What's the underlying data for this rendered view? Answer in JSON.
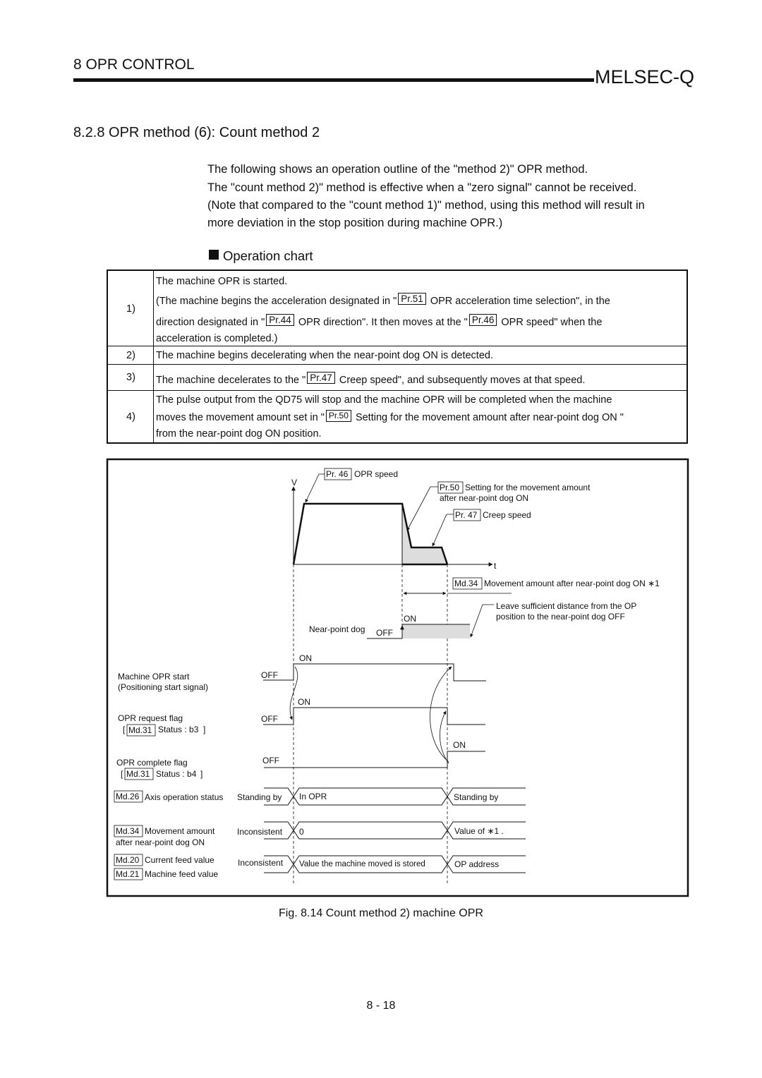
{
  "header": {
    "chapter": "8   OPR CONTROL",
    "brand": "MELSEC-Q"
  },
  "section_title": "8.2.8 OPR method (6): Count method 2",
  "intro": [
    "The following shows an operation outline of the \"method 2)\" OPR method.",
    "The \"count method 2)\" method is effective when a \"zero signal\" cannot be received.",
    "(Note that compared to the \"count method 1)\" method, using this method will result in",
    "more deviation in the stop position during machine OPR.)"
  ],
  "operation_chart_title": "Operation chart",
  "table": {
    "r1": {
      "num": "1)",
      "l1": "The machine OPR is started.",
      "l2a": "(The machine begins the acceleration designated in \"",
      "l2ref": "Pr.51",
      "l2b": "OPR acceleration time selection\", in the",
      "l3a": "direction designated in \"",
      "l3ref1": "Pr.44",
      "l3b": "OPR direction\". It then moves at the \"",
      "l3ref2": "Pr.46",
      "l3c": "OPR speed\" when the",
      "l4": "acceleration is completed.)"
    },
    "r2": {
      "num": "2)",
      "text": "The machine begins decelerating when the near-point dog ON is detected."
    },
    "r3": {
      "num": "3)",
      "a": "The machine decelerates to the \"",
      "ref": "Pr.47",
      "b": "Creep speed\", and subsequently moves at that speed."
    },
    "r4": {
      "num": "4)",
      "l1": "The pulse output from the QD75 will stop and the machine OPR will be completed when the machine",
      "l2a": "moves the movement amount set in \"",
      "l2ref": "Pr.50",
      "l2b": "Setting for the movement amount after near-point dog ON \"",
      "l3": "from the near-point dog ON position."
    }
  },
  "diagram": {
    "v": "V",
    "t": "t",
    "pr46": "Pr. 46",
    "pr46_text": "OPR speed",
    "pr50": "Pr.50",
    "pr50_text1": "Setting for the movement amount",
    "pr50_text2": "after near-point dog ON",
    "pr47": "Pr. 47",
    "pr47_text": "Creep speed",
    "md34": "Md.34",
    "md34_text": "Movement amount after near-point dog ON ∗1",
    "leave1": "Leave sufficient distance from the OP",
    "leave2": "position to the near-point dog OFF",
    "npd": "Near-point dog",
    "on": "ON",
    "off": "OFF",
    "start1": "Machine OPR start",
    "start2": "(Positioning start signal)",
    "req1": "OPR request flag",
    "md31": "Md.31",
    "req_status": "Status : b3",
    "comp1": "OPR complete flag",
    "comp_status": "Status : b4",
    "md26": "Md.26",
    "md26_text": "Axis operation status",
    "standing": "Standing by",
    "in_opr": "In OPR",
    "md34b_text1": "Movement amount",
    "md34b_text2": "after near-point dog ON",
    "inconsistent": "Inconsistent",
    "zero": "0",
    "value_of": "Value of  ∗1 .",
    "md20": "Md.20",
    "md20_text": "Current feed value",
    "md21": "Md.21",
    "md21_text": "Machine feed value",
    "stored": "Value the machine moved is stored",
    "op_address": "OP address"
  },
  "caption": "Fig. 8.14 Count method 2) machine OPR",
  "page_number": "8 - 18"
}
